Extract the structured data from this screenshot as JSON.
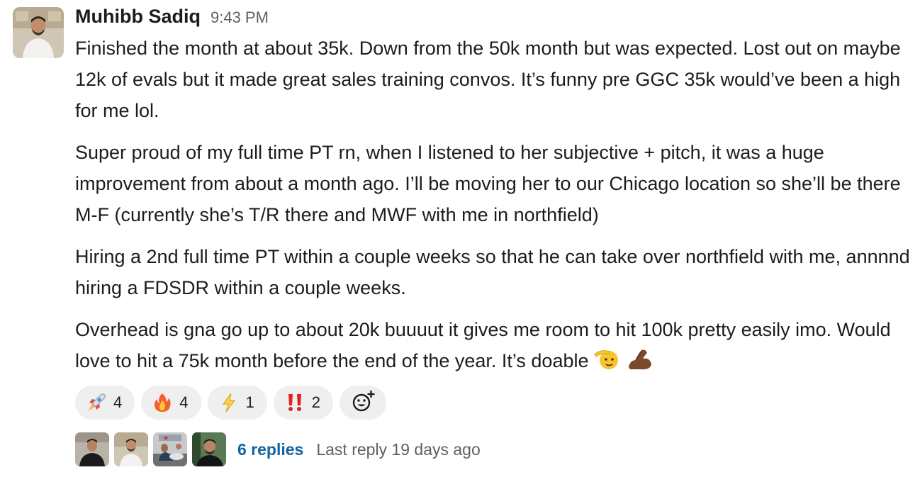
{
  "message": {
    "author": "Muhibb Sadiq",
    "time": "9:43 PM",
    "avatar_icon": "user-avatar-photo",
    "paragraphs": [
      "Finished the month at about 35k. Down from the 50k month but was expected. Lost out on maybe 12k of evals but it made great sales training convos. It’s funny pre GGC 35k would’ve been a high for me lol.",
      "Super proud of my full time PT rn, when I listened to her subjective + pitch, it was a huge improvement from about a month ago. I’ll be moving her to our Chicago location so she’ll be there M-F (currently she’s T/R there and MWF with me in northfield)",
      "Hiring a 2nd full time PT within a couple weeks so that he can take over northfield with me, annnnd hiring a FDSDR within a couple weeks.",
      "Overhead is gna go up to about 20k buuuut it gives me room to hit 100k pretty easily imo. Would love to hit a 75k month before the end of the year. It’s doable"
    ],
    "trailing_emojis": [
      "saluting-face-icon",
      "flexed-biceps-icon"
    ]
  },
  "reactions": [
    {
      "icon": "rocket-icon",
      "count": "4"
    },
    {
      "icon": "fire-icon",
      "count": "4"
    },
    {
      "icon": "lightning-icon",
      "count": "1"
    },
    {
      "icon": "double-exclamation-icon",
      "count": "2"
    }
  ],
  "add_reaction_icon": "add-reaction-icon",
  "thread": {
    "reply_avatars": [
      "reply-avatar-1",
      "reply-avatar-2",
      "reply-avatar-3",
      "reply-avatar-4"
    ],
    "replies_label": "6 replies",
    "last_reply": "Last reply 19 days ago"
  },
  "colors": {
    "link": "#1264a3",
    "muted": "#616061",
    "pill_bg": "#efefef",
    "text": "#1d1c1d"
  }
}
